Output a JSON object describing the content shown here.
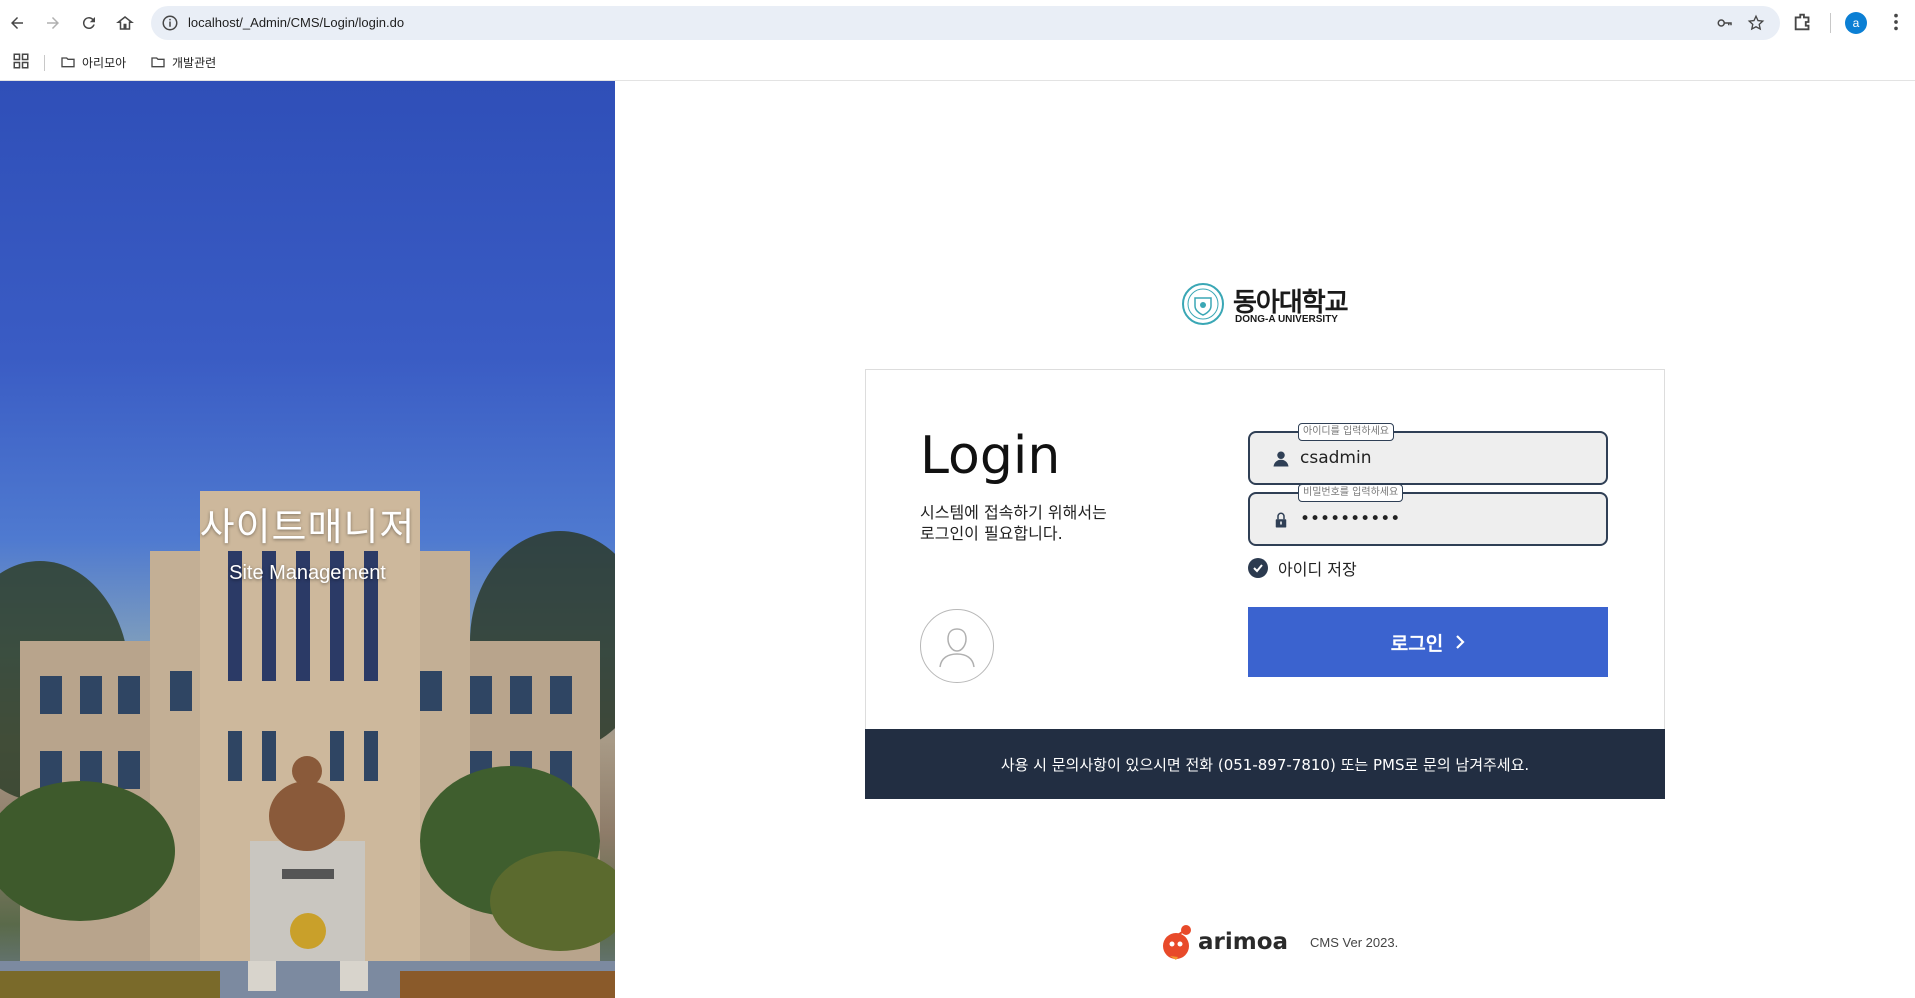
{
  "browser": {
    "url": "localhost/_Admin/CMS/Login/login.do",
    "profile_initial": "a",
    "bookmarks": [
      {
        "label": "아리모아"
      },
      {
        "label": "개발관련"
      }
    ]
  },
  "hero": {
    "title": "사이트매니저",
    "subtitle": "Site Management"
  },
  "logo": {
    "korean": "동아대학교",
    "english": "DONG-A UNIVERSITY"
  },
  "login": {
    "title": "Login",
    "description_line1": "시스템에 접속하기 위해서는",
    "description_line2": "로그인이 필요합니다.",
    "id_field": {
      "label": "아이디를 입력하세요",
      "value": "csadmin"
    },
    "password_field": {
      "label": "비밀번호를 입력하세요",
      "value": "••••••••••"
    },
    "save_id_label": "아이디 저장",
    "save_id_checked": true,
    "button_label": "로그인",
    "footer_notice": "사용 시 문의사항이 있으시면 전화 (051-897-7810) 또는 PMS로 문의 남겨주세요."
  },
  "brand": {
    "name": "arimoa",
    "version": "CMS Ver 2023."
  },
  "colors": {
    "primary_button": "#3b63cf",
    "footer_bar": "#222e42",
    "field_border": "#2f3f55"
  }
}
